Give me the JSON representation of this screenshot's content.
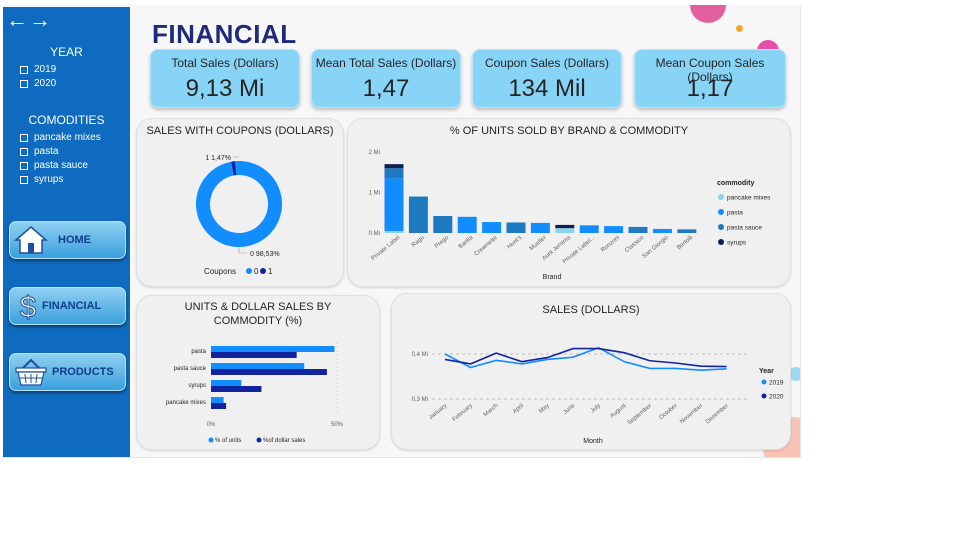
{
  "nav": {
    "back": "←",
    "forward": "→"
  },
  "sidebar": {
    "year_title": "YEAR",
    "years": [
      "2019",
      "2020"
    ],
    "commodities_title": "COMODITIES",
    "commodities": [
      "pancake mixes",
      "pasta",
      "pasta sauce",
      "syrups"
    ],
    "buttons": {
      "home": "HOME",
      "financial": "FINANCIAL",
      "products": "PRODUCTS"
    }
  },
  "page_title": "FINANCIAL",
  "kpis": [
    {
      "label": "Total Sales (Dollars)",
      "value": "9,13 Mi"
    },
    {
      "label": "Mean Total Sales (Dollars)",
      "value": "1,47"
    },
    {
      "label": "Coupon Sales (Dollars)",
      "value": "134 Mil"
    },
    {
      "label": "Mean Coupon Sales (Dollars)",
      "value": "1,17"
    }
  ],
  "colors": {
    "light": "#118dff",
    "dark": "#12239e",
    "kpi": "#88d4f7",
    "sidebar": "#0f6bbf"
  },
  "chart_data": [
    {
      "type": "pie",
      "title": "SALES WITH COUPONS (DOLLARS)",
      "categories": [
        "0",
        "1"
      ],
      "values": [
        98.53,
        1.47
      ],
      "data_labels": [
        "0 98,53%",
        "1 1,47%"
      ],
      "legend_title": "Coupons",
      "legend": [
        "0",
        "1"
      ],
      "colors": [
        "#118dff",
        "#12239e"
      ]
    },
    {
      "type": "bar",
      "title": "% OF UNITS SOLD BY BRAND & COMMODITY",
      "xlabel": "Brand",
      "y_ticks": [
        "0 Mi",
        "1 Mi",
        "2 Mi"
      ],
      "ylim": [
        0,
        2
      ],
      "legend_title": "commodity",
      "legend": [
        "pancake mixes",
        "pasta",
        "pasta sauce",
        "syrups"
      ],
      "legend_colors": [
        "#8ad4eb",
        "#118dff",
        "#1d7ac0",
        "#0c1f4e"
      ],
      "categories": [
        "Private Label",
        "Ragu",
        "Prego",
        "Barilla",
        "Creamette",
        "Hunt's",
        "Mueller",
        "Aunt Jemima",
        "Private Label...",
        "Ronzoni",
        "Classico",
        "San Giorgio",
        "Bertolli"
      ],
      "stacks": [
        [
          0.05,
          1.3,
          0.25,
          0.1
        ],
        [
          0,
          0,
          0.9,
          0
        ],
        [
          0,
          0,
          0.42,
          0
        ],
        [
          0,
          0.4,
          0,
          0
        ],
        [
          0,
          0.27,
          0,
          0
        ],
        [
          0,
          0,
          0.26,
          0
        ],
        [
          0,
          0.25,
          0,
          0
        ],
        [
          0.12,
          0,
          0,
          0.08
        ],
        [
          0,
          0.19,
          0,
          0
        ],
        [
          0,
          0.17,
          0,
          0
        ],
        [
          0,
          0,
          0.15,
          0
        ],
        [
          0,
          0.1,
          0,
          0
        ],
        [
          0,
          0,
          0.09,
          0
        ]
      ]
    },
    {
      "type": "bar",
      "title": "UNITS & DOLLAR SALES BY COMMODITY (%)",
      "orientation": "horizontal",
      "categories": [
        "pasta",
        "pasta sauce",
        "syrups",
        "pancake mixes"
      ],
      "series": [
        {
          "name": "% of units",
          "values": [
            49,
            37,
            12,
            5
          ]
        },
        {
          "name": "%of dollar sales",
          "values": [
            34,
            46,
            20,
            6
          ]
        }
      ],
      "x_ticks": [
        "0%",
        "50%"
      ],
      "xlim": [
        0,
        50
      ]
    },
    {
      "type": "line",
      "title": "SALES (DOLLARS)",
      "xlabel": "Month",
      "legend_title": "Year",
      "categories": [
        "January",
        "February",
        "March",
        "April",
        "May",
        "June",
        "July",
        "August",
        "September",
        "October",
        "November",
        "December"
      ],
      "y_ticks": [
        "0,3 Mi",
        "0,4 Mi"
      ],
      "ylim": [
        0.3,
        0.4
      ],
      "series": [
        {
          "name": "2019",
          "values": [
            0.4,
            0.37,
            0.386,
            0.378,
            0.388,
            0.393,
            0.414,
            0.383,
            0.368,
            0.368,
            0.364,
            0.367
          ]
        },
        {
          "name": "2020",
          "values": [
            0.388,
            0.378,
            0.402,
            0.383,
            0.392,
            0.412,
            0.412,
            0.403,
            0.385,
            0.38,
            0.373,
            0.372
          ]
        }
      ]
    }
  ]
}
